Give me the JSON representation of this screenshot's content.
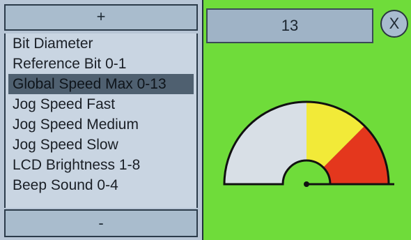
{
  "buttons": {
    "increment_label": "+",
    "decrement_label": "-",
    "close_label": "X"
  },
  "settings_list": {
    "items": [
      "Bit Diameter",
      "Reference Bit 0-1",
      "Global Speed Max 0-13",
      "Jog Speed Fast",
      "Jog Speed Medium",
      "Jog Speed Slow",
      "LCD Brightness 1-8",
      "Beep Sound 0-4"
    ],
    "selected_index": 2
  },
  "value_display": {
    "value": "13"
  },
  "gauge": {
    "level": 1.0,
    "colors": {
      "background": "#6fdc3a",
      "zone_low": "#d8dfe6",
      "zone_mid": "#f2ea38",
      "zone_high": "#e4371d",
      "needle": "#111111"
    }
  }
}
